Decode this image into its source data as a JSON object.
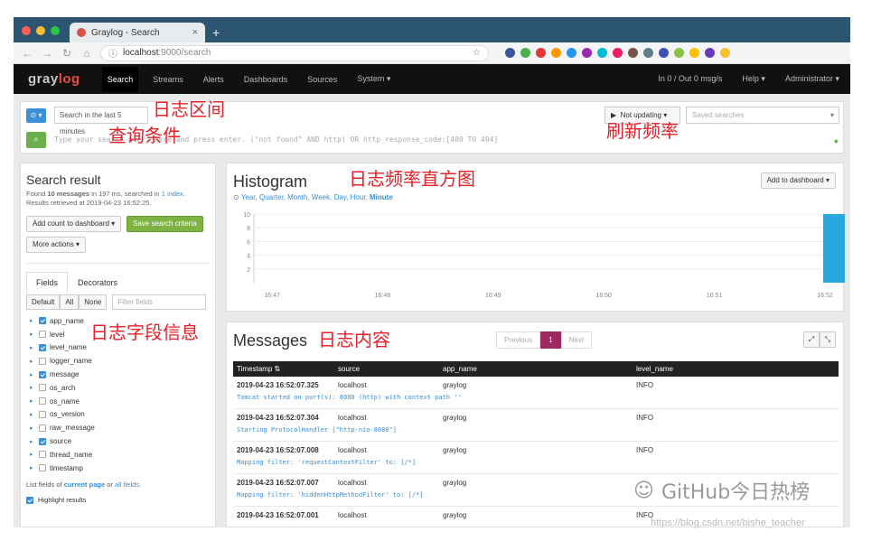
{
  "browser": {
    "tab_title": "Graylog - Search",
    "tab_close": "×",
    "new_tab": "+",
    "url_host": "localhost",
    "url_path": ":9000/search"
  },
  "nav": {
    "logo_a": "gray",
    "logo_b": "log",
    "items": [
      "Search",
      "Streams",
      "Alerts",
      "Dashboards",
      "Sources",
      "System ▾"
    ],
    "throughput": "In 0 / Out 0 msg/s",
    "help": "Help ▾",
    "user": "Administrator ▾"
  },
  "search": {
    "range_select": "⊙ ▾",
    "time_range": "Search in the last 5 minutes",
    "query_placeholder": "Type your search query here and press enter. (\"not found\" AND http) OR http_response_code:[400 TO 404]",
    "update_button": "Not updating ▾",
    "saved_searches": "Saved searches"
  },
  "annotations": {
    "time_range": "日志区间",
    "query": "查询条件",
    "refresh": "刷新频率",
    "histogram": "日志频率直方图",
    "fields": "日志字段信息",
    "messages": "日志内容"
  },
  "sidebar": {
    "title": "Search result",
    "info_pre": "Found ",
    "info_count": "10 messages",
    "info_mid": " in 197 ms, searched in ",
    "info_index": "1 index",
    "info_end": ".",
    "retrieved": "Results retrieved at 2019-04-23 16:52:25.",
    "add_count": "Add count to dashboard ▾",
    "save_criteria": "Save search criteria",
    "more_actions": "More actions ▾",
    "tab_fields": "Fields",
    "tab_decorators": "Decorators",
    "btn_default": "Default",
    "btn_all": "All",
    "btn_none": "None",
    "filter_placeholder": "Filter fields",
    "fields": [
      {
        "name": "app_name",
        "checked": true
      },
      {
        "name": "level",
        "checked": false
      },
      {
        "name": "level_name",
        "checked": true
      },
      {
        "name": "logger_name",
        "checked": false
      },
      {
        "name": "message",
        "checked": true
      },
      {
        "name": "os_arch",
        "checked": false
      },
      {
        "name": "os_name",
        "checked": false
      },
      {
        "name": "os_version",
        "checked": false
      },
      {
        "name": "raw_message",
        "checked": false
      },
      {
        "name": "source",
        "checked": true
      },
      {
        "name": "thread_name",
        "checked": false
      },
      {
        "name": "timestamp",
        "checked": false
      }
    ],
    "list_pre": "List fields of ",
    "list_current": "current page",
    "list_or": " or ",
    "list_all": "all fields",
    "list_end": ".",
    "highlight": "Highlight results"
  },
  "histogram": {
    "title": "Histogram",
    "resolutions": [
      "Year",
      "Quarter",
      "Month",
      "Week",
      "Day",
      "Hour"
    ],
    "active_resolution": "Minute",
    "add_button": "Add to dashboard ▾"
  },
  "chart_data": {
    "type": "bar",
    "title": "Histogram",
    "x": [
      "16:47",
      "16:48",
      "16:49",
      "16:50",
      "16:51",
      "16:52"
    ],
    "values": [
      0,
      0,
      0,
      0,
      0,
      10
    ],
    "ylim": [
      0,
      10
    ],
    "yticks": [
      2,
      4,
      6,
      8,
      10
    ],
    "bar_color": "#29a8e0",
    "grid": true
  },
  "messages": {
    "title": "Messages",
    "prev": "Previous",
    "page": "1",
    "next": "Next",
    "expand": "⤢",
    "collapse": "⤡",
    "columns": [
      "Timestamp ⇅",
      "source",
      "app_name",
      "level_name"
    ],
    "rows": [
      {
        "timestamp": "2019-04-23 16:52:07.325",
        "source": "localhost",
        "app_name": "graylog",
        "level": "INFO",
        "message": "Tomcat started on port(s): 8080 (http) with context path ''"
      },
      {
        "timestamp": "2019-04-23 16:52:07.304",
        "source": "localhost",
        "app_name": "graylog",
        "level": "INFO",
        "message": "Starting ProtocolHandler [\"http-nio-8080\"]"
      },
      {
        "timestamp": "2019-04-23 16:52:07.008",
        "source": "localhost",
        "app_name": "graylog",
        "level": "INFO",
        "message": "Mapping filter: 'requestContextFilter' to: [/*]"
      },
      {
        "timestamp": "2019-04-23 16:52:07.007",
        "source": "localhost",
        "app_name": "graylog",
        "level": "",
        "message": "Mapping filter: 'hiddenHttpMethodFilter' to: [/*]"
      },
      {
        "timestamp": "2019-04-23 16:52:07.001",
        "source": "localhost",
        "app_name": "graylog",
        "level": "INFO",
        "message": ""
      }
    ]
  },
  "watermark": {
    "text": "GitHub今日热榜",
    "url": "https://blog.csdn.net/bishe_teacher"
  }
}
